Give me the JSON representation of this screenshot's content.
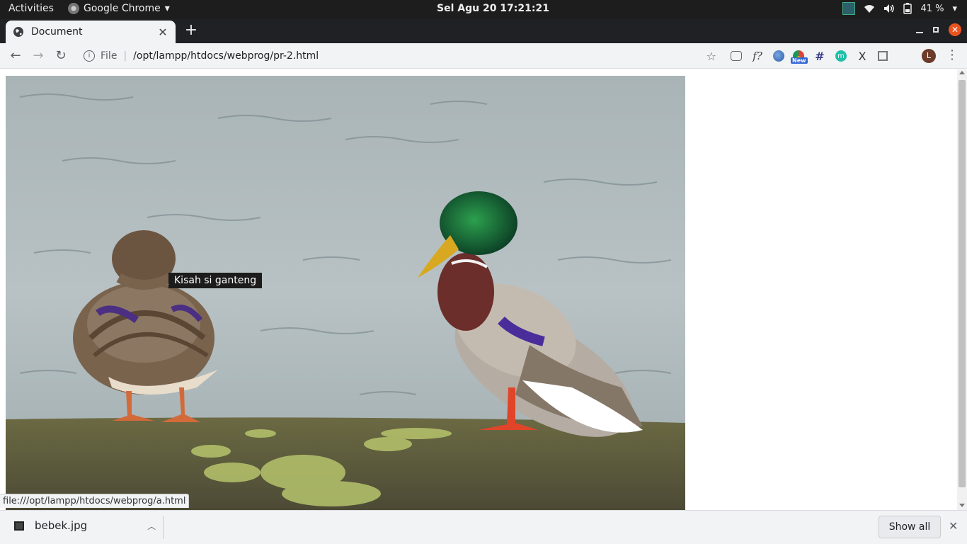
{
  "topbar": {
    "activities": "Activities",
    "app_name": "Google Chrome",
    "clock": "Sel Agu 20  17:21:21",
    "battery": "41 %"
  },
  "tab": {
    "title": "Document"
  },
  "omnibox": {
    "scheme": "File",
    "url": "/opt/lampp/htdocs/webprog/pr-2.html"
  },
  "extensions": {
    "new_badge": "New"
  },
  "profile": {
    "initial": "L"
  },
  "page": {
    "image_title_tooltip": "Kisah si ganteng",
    "status_link": "file:///opt/lampp/htdocs/webprog/a.html"
  },
  "downloads": {
    "file": "bebek.jpg",
    "show_all": "Show all"
  }
}
